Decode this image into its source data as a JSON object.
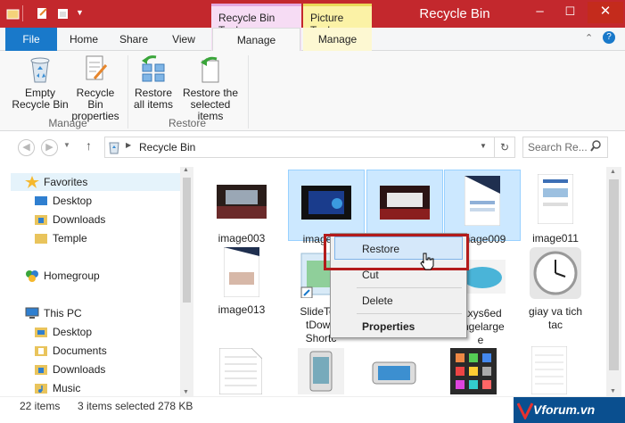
{
  "window": {
    "title": "Recycle Bin",
    "controls": {
      "minimize": "–",
      "maximize": "☐",
      "close": "✕"
    }
  },
  "context_tabs": {
    "recycle_bin_tools": "Recycle Bin Tools",
    "picture_tools": "Picture Tools"
  },
  "ribbon_tabs": {
    "file": "File",
    "home": "Home",
    "share": "Share",
    "view": "View",
    "manage": "Manage",
    "manage2": "Manage"
  },
  "ribbon": {
    "empty_line1": "Empty",
    "empty_line2": "Recycle Bin",
    "props_line1": "Recycle Bin",
    "props_line2": "properties",
    "restore_all_line1": "Restore",
    "restore_all_line2": "all items",
    "restore_sel_line1": "Restore the",
    "restore_sel_line2": "selected items",
    "group_manage": "Manage",
    "group_restore": "Restore"
  },
  "address": {
    "location": "Recycle Bin",
    "search_placeholder": "Search Re..."
  },
  "nav": {
    "favorites": "Favorites",
    "desktop": "Desktop",
    "downloads": "Downloads",
    "temple": "Temple",
    "homegroup": "Homegroup",
    "this_pc": "This PC",
    "pc_desktop": "Desktop",
    "pc_documents": "Documents",
    "pc_downloads": "Downloads",
    "pc_music": "Music"
  },
  "files": {
    "f1": "image003",
    "f2": "image005",
    "f3": "image007",
    "f4": "image009",
    "f5": "image011",
    "f6": "image013",
    "f7_l1": "SlideToS",
    "f7_l2": "tDown",
    "f7_l3": "Shortc",
    "f8_l1": "laxys6ed",
    "f8_l2": "angelarge",
    "f8_l3": "e",
    "f9_l1": "giay va tich",
    "f9_l2": "tac"
  },
  "context_menu": {
    "restore": "Restore",
    "cut": "Cut",
    "delete": "Delete",
    "properties": "Properties"
  },
  "status": {
    "count": "22 items",
    "selection": "3 items selected",
    "size": "278 KB"
  },
  "watermark": "Vforum.vn",
  "colors": {
    "titlebar": "#c3282d",
    "file_tab": "#1979ca",
    "selection": "#cce8ff",
    "highlight": "#b31b1b"
  }
}
